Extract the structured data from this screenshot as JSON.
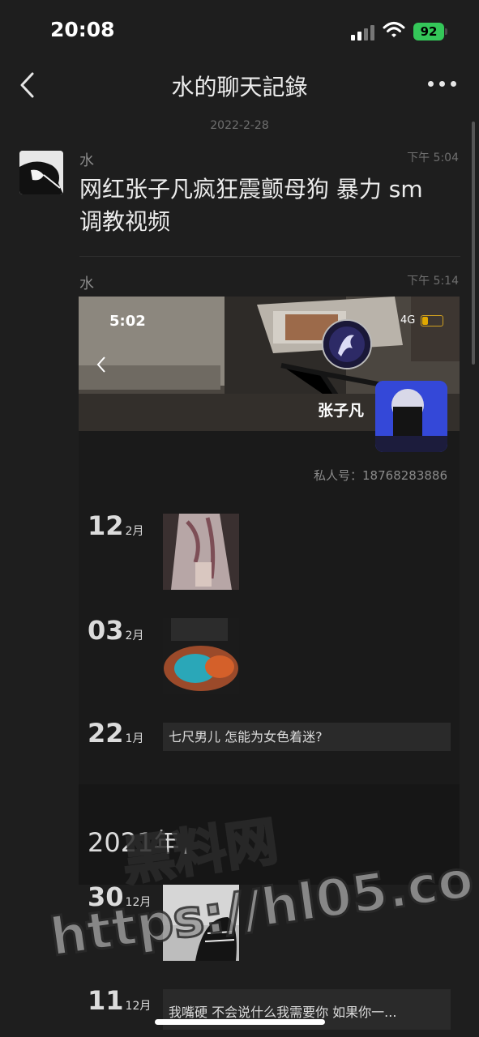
{
  "status_bar": {
    "time": "20:08",
    "battery": "92"
  },
  "nav": {
    "title": "水的聊天記錄"
  },
  "chat": {
    "date_separator": "2022-2-28",
    "messages": [
      {
        "sender": "水",
        "time": "下午 5:04",
        "text": "网红张子凡疯狂震颤母狗 暴力 sm 调教视频"
      },
      {
        "sender": "水",
        "time": "下午 5:14"
      }
    ]
  },
  "card": {
    "screenshot": {
      "time": "5:02",
      "network": "4G",
      "name": "张子凡"
    },
    "private_number": "私人号：18768283886",
    "posts": [
      {
        "day": "12",
        "month": "2月"
      },
      {
        "day": "03",
        "month": "2月"
      },
      {
        "day": "22",
        "month": "1月",
        "text": "七尺男儿 怎能为女色着迷?"
      }
    ],
    "year": "2021年",
    "posts_2021": [
      {
        "day": "30",
        "month": "12月"
      },
      {
        "day": "11",
        "month": "12月",
        "text": "我嘴硬 不会说什么我需要你 如果你一..."
      }
    ]
  },
  "watermark": {
    "line1": "黑料网",
    "line2": "https://hl05.co"
  },
  "colors": {
    "background": "#1e1e1e",
    "battery": "#34c759"
  }
}
